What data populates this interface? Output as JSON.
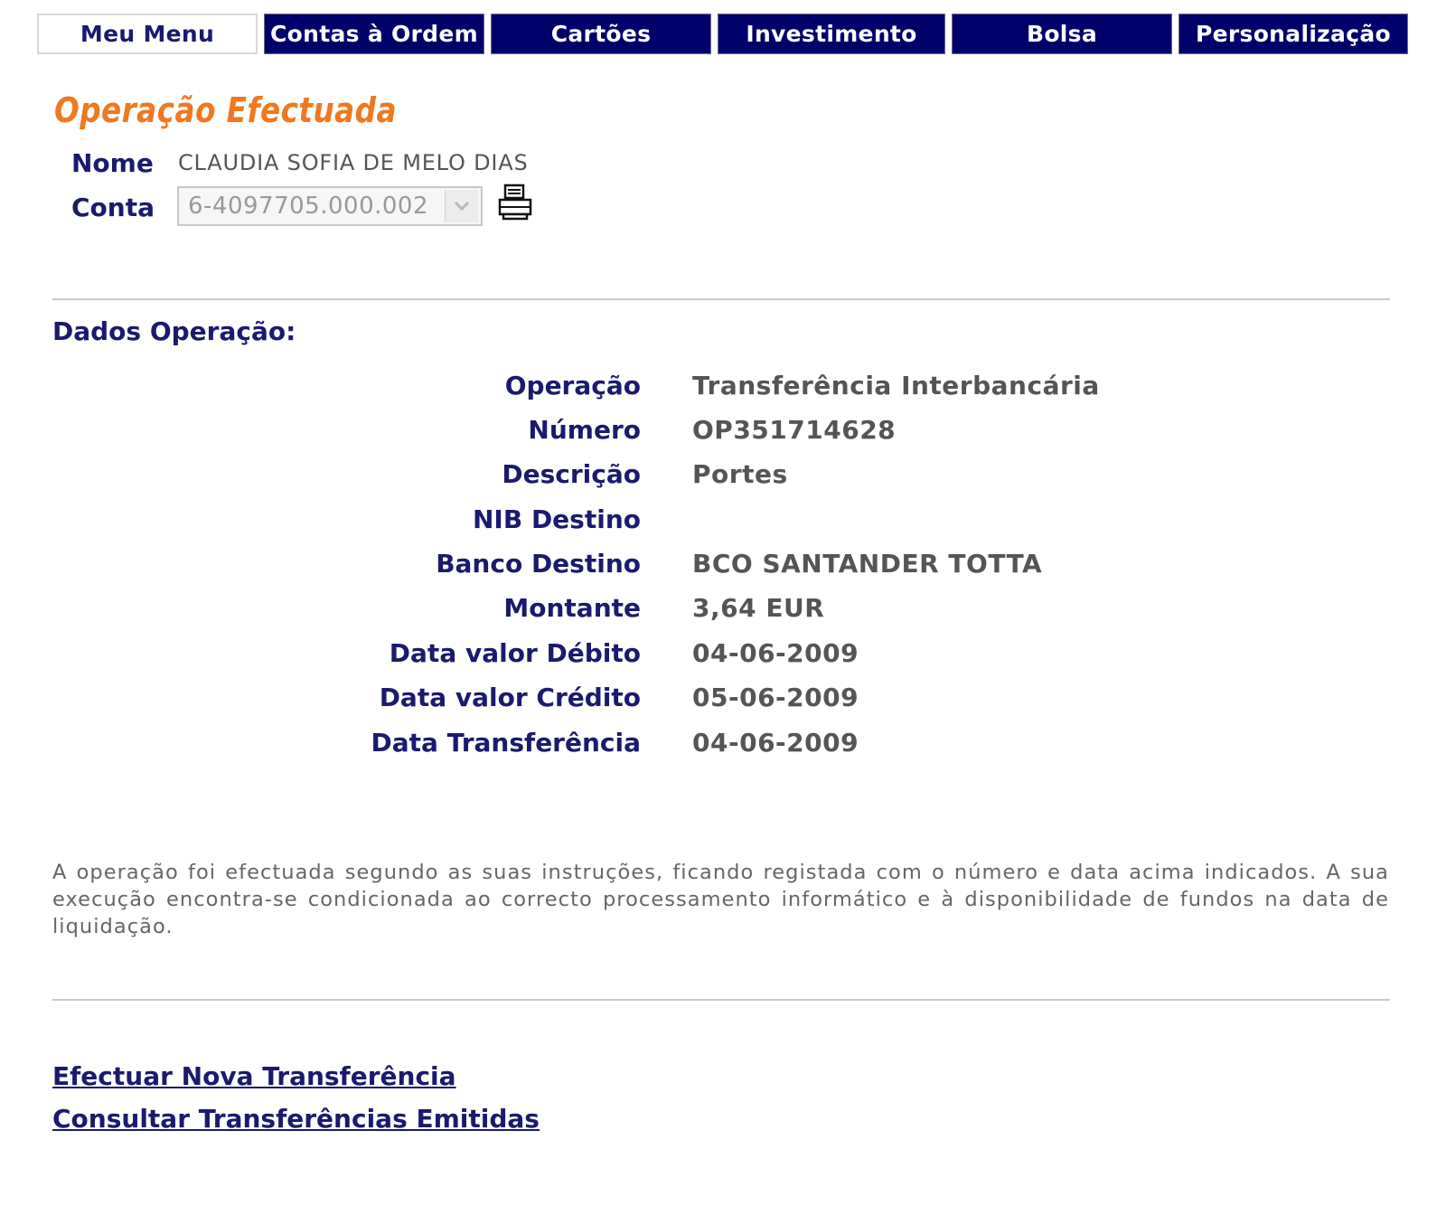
{
  "tabs": [
    {
      "label": "Meu Menu"
    },
    {
      "label": "Contas à Ordem"
    },
    {
      "label": "Cartões"
    },
    {
      "label": "Investimento"
    },
    {
      "label": "Bolsa"
    },
    {
      "label": "Personalização"
    }
  ],
  "colors": {
    "accent": "#f07820",
    "nav": "#00006b",
    "label": "#1a1a6e",
    "value": "#555555"
  },
  "header": {
    "title": "Operação Efectuada",
    "nome_label": "Nome",
    "nome_value": "CLAUDIA SOFIA DE MELO DIAS",
    "conta_label": "Conta",
    "conta_value": "6-4097705.000.002",
    "print_icon": "printer-icon"
  },
  "section": {
    "title": "Dados Operação:"
  },
  "details": [
    {
      "label": "Operação",
      "value": "Transferência Interbancária"
    },
    {
      "label": "Número",
      "value": "OP351714628"
    },
    {
      "label": "Descrição",
      "value": "Portes"
    },
    {
      "label": "NIB Destino",
      "value": ""
    },
    {
      "label": "Banco Destino",
      "value": "BCO SANTANDER TOTTA"
    },
    {
      "label": "Montante",
      "value": "3,64 EUR"
    },
    {
      "label": "Data valor Débito",
      "value": "04-06-2009"
    },
    {
      "label": "Data valor Crédito",
      "value": "05-06-2009"
    },
    {
      "label": "Data Transferência",
      "value": "04-06-2009"
    }
  ],
  "notice": "A operação foi efectuada segundo as suas instruções, ficando registada com o número e data acima indicados. A sua execução encontra-se condicionada ao correcto processamento informático e à disponibilidade de fundos na data de liquidação.",
  "links": {
    "new_transfer": "Efectuar Nova Transferência",
    "consult_transfers": "Consultar Transferências Emitidas"
  }
}
